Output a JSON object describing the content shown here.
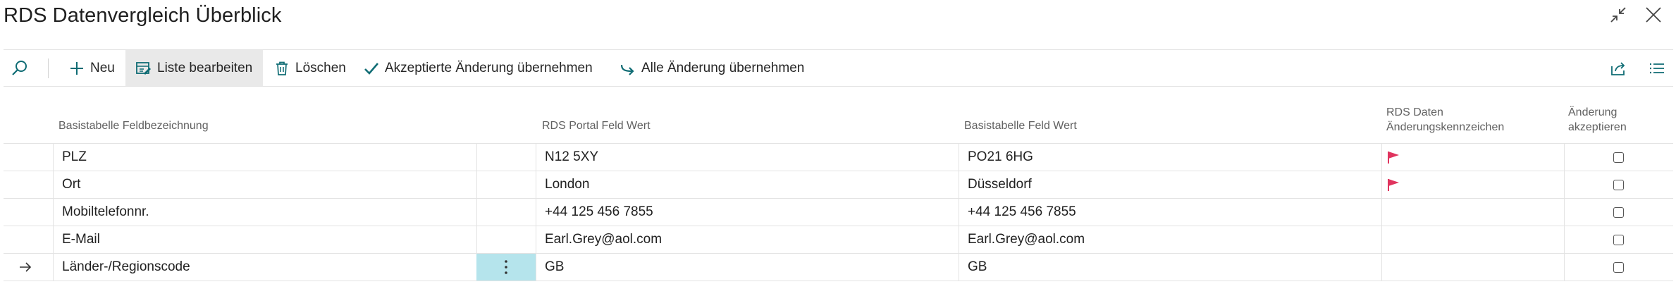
{
  "window": {
    "title": "RDS Datenvergleich Überblick",
    "collapse_icon": "collapse-icon",
    "close_icon": "close-icon"
  },
  "toolbar": {
    "search_icon": "search-icon",
    "new_label": "Neu",
    "edit_list_label": "Liste bearbeiten",
    "delete_label": "Löschen",
    "accept_accepted_label": "Akzeptierte Änderung übernehmen",
    "accept_all_label": "Alle Änderung übernehmen",
    "share_icon": "share-icon",
    "list_view_icon": "list-view-icon"
  },
  "table": {
    "columns": {
      "field_name": "Basistabelle Feldbezeichnung",
      "portal_value": "RDS Portal Feld Wert",
      "base_value": "Basistabelle Feld Wert",
      "change_flag_line1": "RDS Daten",
      "change_flag_line2": "Änderungskennzeichen",
      "accept_line1": "Änderung",
      "accept_line2": "akzeptieren"
    },
    "rows": [
      {
        "field": "PLZ",
        "portal": "N12 5XY",
        "base": "PO21 6HG",
        "flag": true,
        "accept": false,
        "current": false
      },
      {
        "field": "Ort",
        "portal": "London",
        "base": "Düsseldorf",
        "flag": true,
        "accept": false,
        "current": false
      },
      {
        "field": "Mobiltelefonnr.",
        "portal": "+44 125 456 7855",
        "base": "+44 125 456 7855",
        "flag": false,
        "accept": false,
        "current": false
      },
      {
        "field": "E-Mail",
        "portal": "Earl.Grey@aol.com",
        "base": "Earl.Grey@aol.com",
        "flag": false,
        "accept": false,
        "current": false
      },
      {
        "field": "Länder-/Regionscode",
        "portal": "GB",
        "base": "GB",
        "flag": false,
        "accept": false,
        "current": true
      }
    ]
  },
  "colors": {
    "accent": "#0f6c74",
    "flag": "#e0345e",
    "selected_cell": "#b5e4ec"
  }
}
